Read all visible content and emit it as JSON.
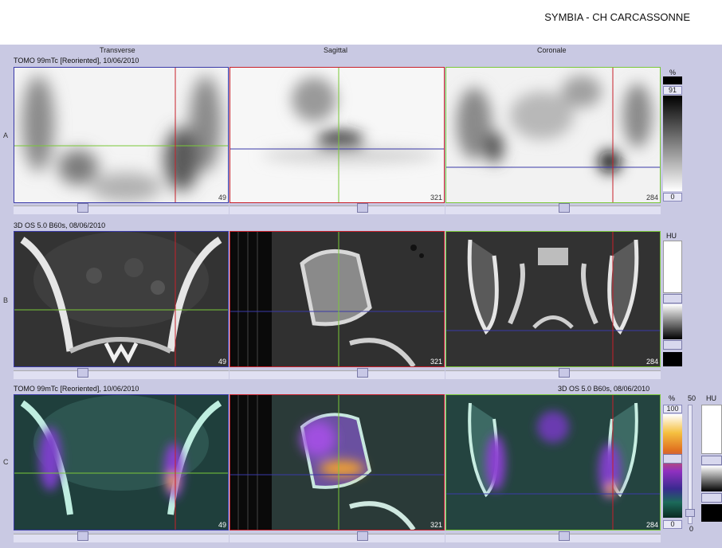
{
  "header": {
    "title": "SYMBIA - CH CARCASSONNE"
  },
  "columns": [
    "Transverse",
    "Sagittal",
    "Coronale"
  ],
  "rows": [
    {
      "letter": "A",
      "series": "TOMO 99mTc [Reoriented], 10/06/2010"
    },
    {
      "letter": "B",
      "series": "3D  OS  5.0  B60s, 08/06/2010"
    },
    {
      "letter": "C",
      "series": "TOMO 99mTc [Reoriented], 10/06/2010",
      "series_right": "3D  OS  5.0  B60s, 08/06/2010"
    }
  ],
  "slice_numbers": [
    "49",
    "321",
    "284"
  ],
  "scales": {
    "nm": {
      "unit": "%",
      "top": "91",
      "bottom": "0"
    },
    "ct": {
      "unit": "HU"
    },
    "fusion": {
      "unit": "%",
      "top": "100",
      "bottom": "0",
      "extra": "50",
      "unit2": "HU",
      "bottom2": "0"
    }
  },
  "colors": {
    "transverse": "#c8202a",
    "sagittal": "#7ac838",
    "coronal": "#3a3aa8"
  }
}
